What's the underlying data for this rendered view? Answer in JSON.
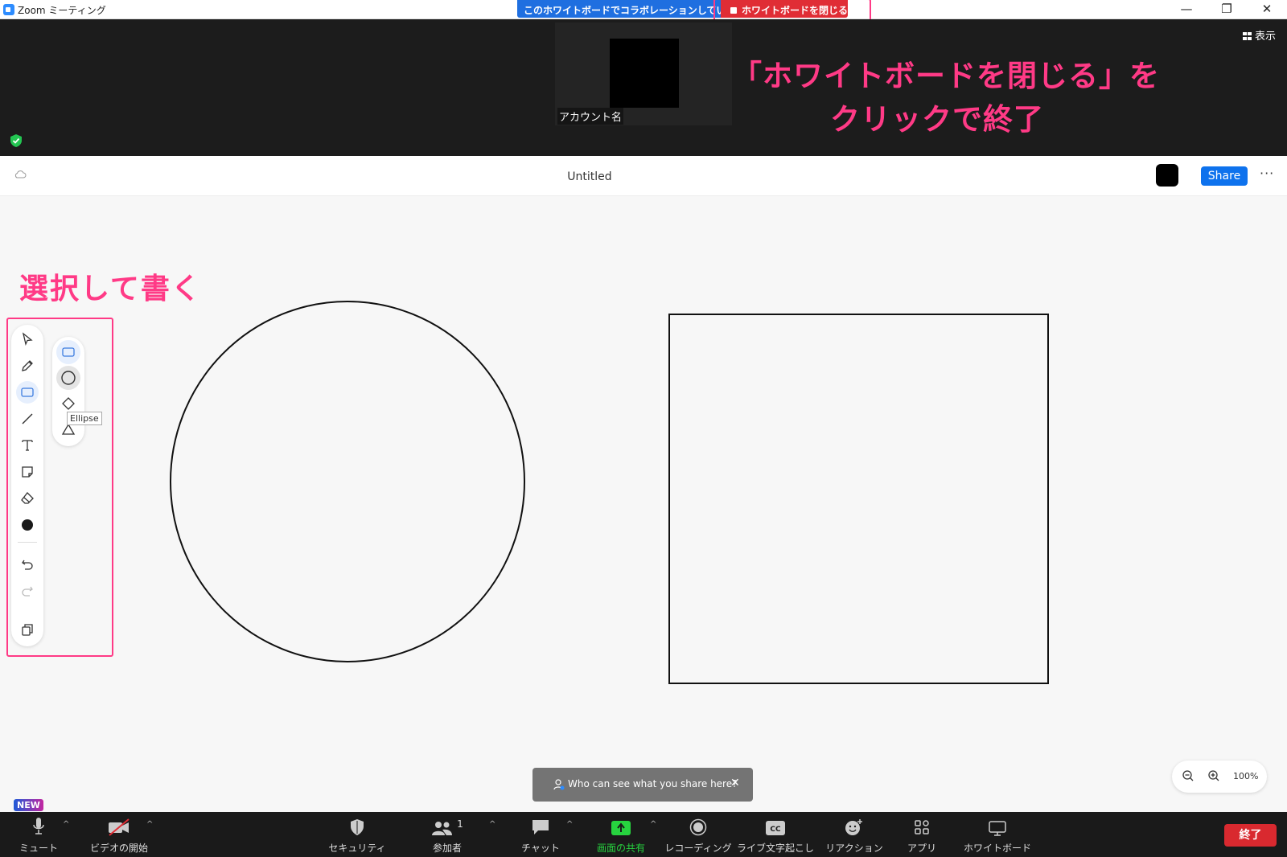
{
  "window": {
    "title": "Zoom ミーティング",
    "controls": {
      "minimize": "—",
      "restore": "❐",
      "close": "✕"
    }
  },
  "whiteboard_banner": {
    "collab_text": "このホワイトボードでコラボレーションしています",
    "close_label": "ホワイトボードを閉じる"
  },
  "video": {
    "participant_name": "アカウント名",
    "view_label": "表示"
  },
  "annotations": {
    "top_line1": "「ホワイトボードを閉じる」を",
    "top_line2": "クリックで終了",
    "left": "選択して書く"
  },
  "whiteboard": {
    "title": "Untitled",
    "share_label": "Share",
    "more_label": "···",
    "swatch_color": "#000000",
    "tools": [
      {
        "name": "select-tool",
        "icon": "cursor-icon"
      },
      {
        "name": "pen-tool",
        "icon": "pen-icon"
      },
      {
        "name": "shape-tool",
        "icon": "rectangle-icon",
        "active": true
      },
      {
        "name": "line-tool",
        "icon": "line-icon"
      },
      {
        "name": "text-tool",
        "icon": "text-icon"
      },
      {
        "name": "sticky-note-tool",
        "icon": "sticky-note-icon"
      },
      {
        "name": "eraser-tool",
        "icon": "eraser-icon"
      },
      {
        "name": "color-tool",
        "icon": "color-dot-icon"
      },
      {
        "name": "undo-button",
        "icon": "undo-icon"
      },
      {
        "name": "redo-button",
        "icon": "redo-icon"
      },
      {
        "name": "templates-button",
        "icon": "templates-icon"
      }
    ],
    "shape_options": [
      "rectangle",
      "ellipse",
      "diamond",
      "triangle"
    ],
    "tooltip": "Ellipse",
    "toast": "Who can see what you share here?",
    "zoom_level": "100%"
  },
  "bottombar": {
    "new_badge": "NEW",
    "mute": "ミュート",
    "video_start": "ビデオの開始",
    "security": "セキュリティ",
    "participants": "参加者",
    "participants_count": "1",
    "chat": "チャット",
    "share_screen": "画面の共有",
    "recording": "レコーディング",
    "live_transcript": "ライブ文字起こし",
    "reactions": "リアクション",
    "apps": "アプリ",
    "whiteboard": "ホワイトボード",
    "end": "終了",
    "cc": "CC"
  }
}
